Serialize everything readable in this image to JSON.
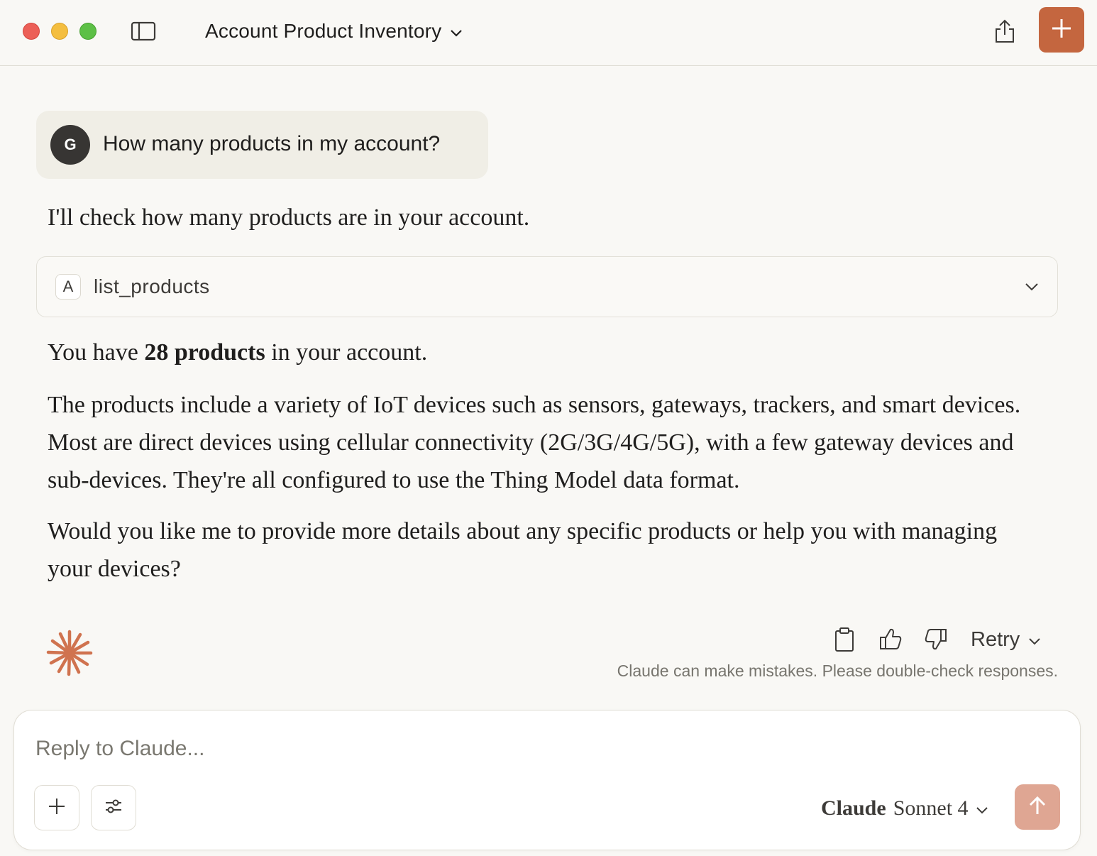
{
  "header": {
    "title": "Account Product Inventory",
    "accent_color": "#c4663f"
  },
  "user_message": {
    "avatar_initial": "G",
    "text": "How many products in my account?"
  },
  "assistant": {
    "intro": "I'll check how many products are in your account.",
    "tool_call": {
      "badge": "A",
      "name": "list_products"
    },
    "answer_prefix": "You have ",
    "answer_bold": "28 products",
    "answer_suffix": " in your account.",
    "paragraph_2": "The products include a variety of IoT devices such as sensors, gateways, trackers, and smart devices. Most are direct devices using cellular connectivity (2G/3G/4G/5G), with a few gateway devices and sub-devices. They're all configured to use the Thing Model data format.",
    "paragraph_3": "Would you like me to provide more details about any specific products or help you with managing your devices?",
    "retry_label": "Retry",
    "disclaimer": "Claude can make mistakes. Please double-check responses."
  },
  "composer": {
    "placeholder": "Reply to Claude...",
    "model_brand": "Claude",
    "model_name": "Sonnet 4"
  }
}
